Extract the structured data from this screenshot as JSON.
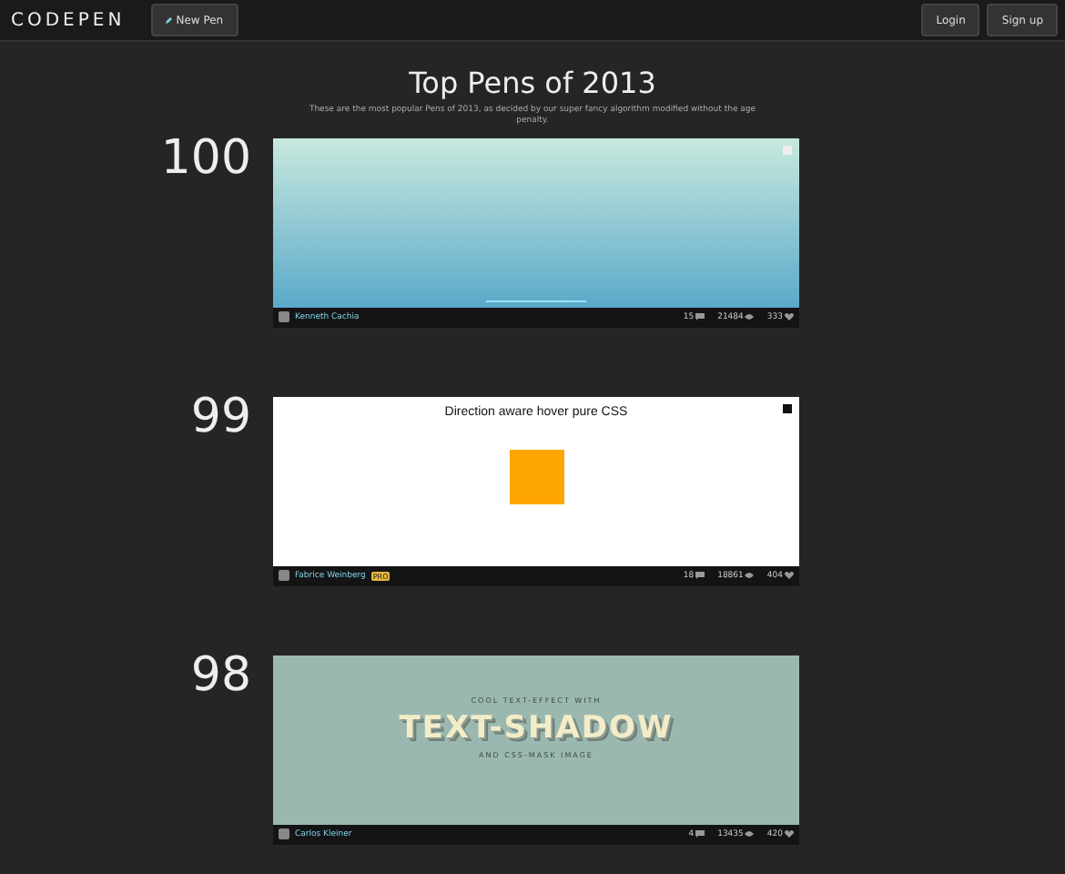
{
  "header": {
    "logo": "CODEPEN",
    "new_pen": "New Pen",
    "login": "Login",
    "signup": "Sign up"
  },
  "title": "Top Pens of 2013",
  "subtitle": "These are the most popular Pens of 2013, as decided by our super fancy algorithm modified without the age penalty.",
  "pens": [
    {
      "rank": "100",
      "kind": "gradient",
      "author": "Kenneth Cachia",
      "comments": "15",
      "views": "21484",
      "hearts": "333"
    },
    {
      "rank": "99",
      "kind": "hover",
      "heading": "Direction aware hover pure CSS",
      "author": "Fabrice Weinberg",
      "badge": "PRO",
      "comments": "18",
      "views": "18861",
      "hearts": "404"
    },
    {
      "rank": "98",
      "kind": "textshadow",
      "line_1": "COOL TEXT-EFFECT WITH",
      "big": "TEXT-SHADOW",
      "line_2": "AND CSS-MASK IMAGE",
      "author": "Carlos Kleiner",
      "comments": "4",
      "views": "13435",
      "hearts": "420"
    }
  ]
}
